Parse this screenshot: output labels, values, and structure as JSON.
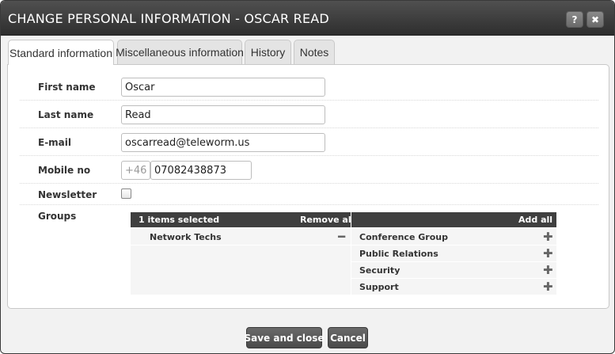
{
  "dialog": {
    "title": "CHANGE PERSONAL INFORMATION - OSCAR READ",
    "help_label": "?",
    "close_label": "✖"
  },
  "tabs": [
    {
      "label": "Standard information",
      "active": true
    },
    {
      "label": "Miscellaneous information",
      "active": false
    },
    {
      "label": "History",
      "active": false
    },
    {
      "label": "Notes",
      "active": false
    }
  ],
  "form": {
    "first_name": {
      "label": "First name",
      "value": "Oscar"
    },
    "last_name": {
      "label": "Last name",
      "value": "Read"
    },
    "email": {
      "label": "E-mail",
      "value": "oscarread@teleworm.us"
    },
    "mobile": {
      "label": "Mobile no",
      "prefix": "+46",
      "value": "07082438873"
    },
    "newsletter": {
      "label": "Newsletter",
      "checked": false
    },
    "groups": {
      "label": "Groups"
    }
  },
  "groups": {
    "selected_header": "1 items selected",
    "remove_all_label": "Remove all",
    "add_all_label": "Add all",
    "selected": [
      {
        "name": "Network Techs",
        "icon": "minus-icon",
        "glyph": "━"
      }
    ],
    "available": [
      {
        "name": "Conference Group",
        "icon": "plus-icon",
        "glyph": "✚"
      },
      {
        "name": "Public Relations",
        "icon": "plus-icon",
        "glyph": "✚"
      },
      {
        "name": "Security",
        "icon": "plus-icon",
        "glyph": "✚"
      },
      {
        "name": "Support",
        "icon": "plus-icon",
        "glyph": "✚"
      }
    ]
  },
  "footer": {
    "save_label": "Save and close",
    "cancel_label": "Cancel"
  }
}
